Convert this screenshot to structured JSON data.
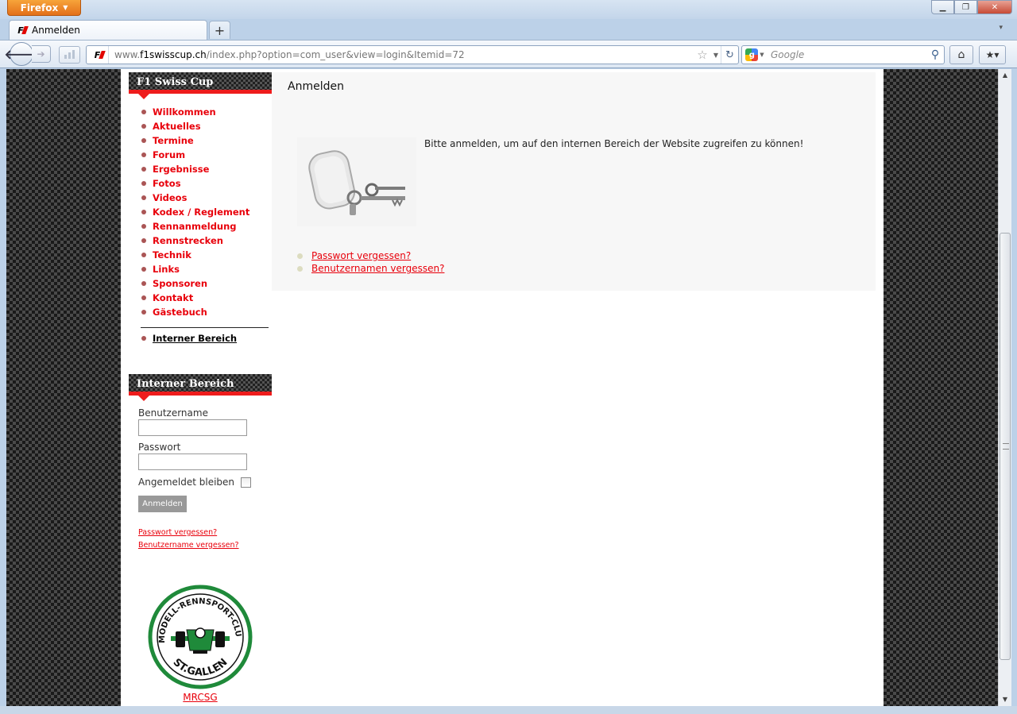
{
  "browser": {
    "menu_button": "Firefox",
    "tab_title": "Anmelden",
    "url_domain": "www.f1swisscup.ch",
    "url_host_bold": "f1swisscup.ch",
    "url_prefix": "www.",
    "url_path": "/index.php?option=com_user&view=login&Itemid=72",
    "search_placeholder": "Google",
    "new_tab_label": "+"
  },
  "sidebar": {
    "title": "F1 Swiss Cup",
    "items": [
      {
        "label": "Willkommen"
      },
      {
        "label": "Aktuelles"
      },
      {
        "label": "Termine"
      },
      {
        "label": "Forum"
      },
      {
        "label": "Ergebnisse"
      },
      {
        "label": "Fotos"
      },
      {
        "label": "Videos"
      },
      {
        "label": "Kodex / Reglement"
      },
      {
        "label": "Rennanmeldung"
      },
      {
        "label": "Rennstrecken"
      },
      {
        "label": "Technik"
      },
      {
        "label": "Links"
      },
      {
        "label": "Sponsoren"
      },
      {
        "label": "Kontakt"
      },
      {
        "label": "Gästebuch"
      }
    ],
    "secondary_item": "Interner Bereich"
  },
  "login_module": {
    "title": "Interner Bereich",
    "username_label": "Benutzername",
    "password_label": "Passwort",
    "remember_label": "Angemeldet bleiben",
    "submit_label": "Anmelden",
    "forgot_password": "Passwort vergessen?",
    "forgot_username": "Benutzername vergessen?"
  },
  "club": {
    "logo_text_top": "MODELL-RENNSPORT-CLUB",
    "logo_text_bottom": "ST.GALLEN",
    "link": "MRCSG"
  },
  "main": {
    "heading": "Anmelden",
    "description": "Bitte anmelden, um auf den internen Bereich der Website zugreifen zu können!",
    "links": [
      {
        "label": "Passwort vergessen?"
      },
      {
        "label": "Benutzernamen vergessen?"
      }
    ]
  },
  "colors": {
    "accent_red": "#e8000b",
    "firefox_orange": "#e3701a",
    "logo_green": "#1f8a3a"
  }
}
